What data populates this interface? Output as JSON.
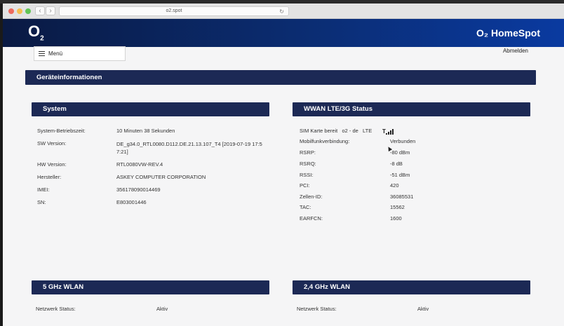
{
  "browser": {
    "url": "o2.spot"
  },
  "header": {
    "logo": "O",
    "logo_sub": "2",
    "brand": "O₂ HomeSpot"
  },
  "nav": {
    "menu_label": "Menü",
    "logout_label": "Abmelden"
  },
  "main_title": "Geräteinformationen",
  "system": {
    "title": "System",
    "rows": [
      {
        "label": "System-Betriebszeit:",
        "value": "10 Minuten 38 Sekunden"
      },
      {
        "label": "SW Version:",
        "value": "DE_g34.0_RTL0080.D112.DE.21.13.107_T4 [2019-07-19 17:57:21]"
      },
      {
        "label": "HW Version:",
        "value": "RTL0080VW-REV.4"
      },
      {
        "label": "Hersteller:",
        "value": "ASKEY COMPUTER CORPORATION"
      },
      {
        "label": "IMEI:",
        "value": "356178090014469"
      },
      {
        "label": "SN:",
        "value": "E803001446"
      }
    ]
  },
  "wwan": {
    "title": "WWAN LTE/3G Status",
    "sim_status": "SIM Karte bereit   o2 - de   LTE",
    "signal_bars": 4,
    "rows": [
      {
        "label": "Mobilfunkverbindung:",
        "value": "Verbunden"
      },
      {
        "label": "RSRP:",
        "value": "-80 dBm"
      },
      {
        "label": "RSRQ:",
        "value": "-8 dB"
      },
      {
        "label": "RSSI:",
        "value": "-51 dBm"
      },
      {
        "label": "PCI:",
        "value": "420"
      },
      {
        "label": "Zellen-ID:",
        "value": "36085531"
      },
      {
        "label": "TAC:",
        "value": "15562"
      },
      {
        "label": "EARFCN:",
        "value": "1600"
      }
    ]
  },
  "wlan5": {
    "title": "5 GHz WLAN",
    "status_label": "Netzwerk Status:",
    "status_value": "Aktiv"
  },
  "wlan24": {
    "title": "2,4 GHz WLAN",
    "status_label": "Netzwerk Status:",
    "status_value": "Aktiv"
  },
  "colors": {
    "banner": "#1c2955",
    "header_start": "#0a1a43",
    "header_end": "#0a3aa0"
  }
}
